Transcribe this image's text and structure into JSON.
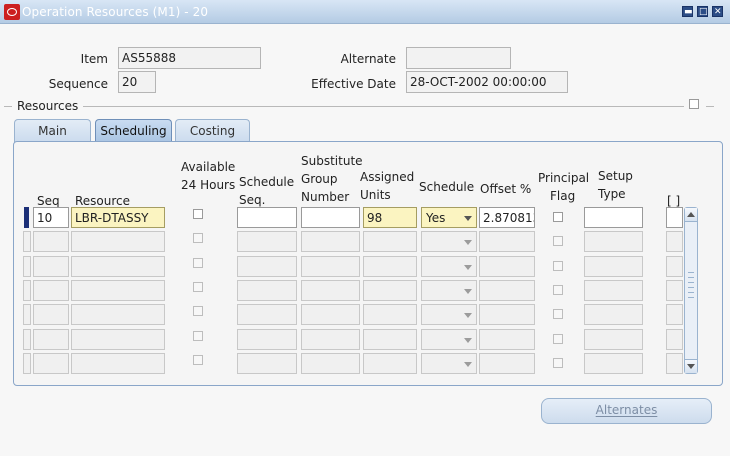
{
  "window": {
    "title": "Operation Resources (M1) - 20",
    "minimize": "▬",
    "maximize": "□",
    "close": "✕"
  },
  "header": {
    "item_label": "Item",
    "item_value": "AS55888",
    "alternate_label": "Alternate",
    "alternate_value": "",
    "sequence_label": "Sequence",
    "sequence_value": "20",
    "effective_date_label": "Effective Date",
    "effective_date_value": "28-OCT-2002 00:00:00"
  },
  "resources_section": {
    "label": "Resources"
  },
  "tabs": [
    {
      "label": "Main"
    },
    {
      "label": "Scheduling"
    },
    {
      "label": "Costing"
    }
  ],
  "columns": {
    "seq": "Seq",
    "resource": "Resource",
    "available_24_hours": [
      "Available",
      "24 Hours"
    ],
    "schedule_seq": [
      "Schedule",
      "Seq."
    ],
    "substitute_group_number": [
      "Substitute",
      "Group",
      "Number"
    ],
    "assigned_units": [
      "Assigned",
      "Units"
    ],
    "schedule": "Schedule",
    "offset_percent": "Offset %",
    "principal_flag": [
      "Principal",
      "Flag"
    ],
    "setup_type": [
      "Setup",
      "Type"
    ],
    "dff": "[ ]"
  },
  "rows": [
    {
      "seq": "10",
      "resource": "LBR-DTASSY",
      "schedule_seq": "",
      "substitute_group": "",
      "assigned_units": "98",
      "schedule": "Yes",
      "offset": "2.870813",
      "setup_type": ""
    },
    {
      "seq": "",
      "resource": "",
      "schedule_seq": "",
      "substitute_group": "",
      "assigned_units": "",
      "schedule": "",
      "offset": "",
      "setup_type": ""
    },
    {
      "seq": "",
      "resource": "",
      "schedule_seq": "",
      "substitute_group": "",
      "assigned_units": "",
      "schedule": "",
      "offset": "",
      "setup_type": ""
    },
    {
      "seq": "",
      "resource": "",
      "schedule_seq": "",
      "substitute_group": "",
      "assigned_units": "",
      "schedule": "",
      "offset": "",
      "setup_type": ""
    },
    {
      "seq": "",
      "resource": "",
      "schedule_seq": "",
      "substitute_group": "",
      "assigned_units": "",
      "schedule": "",
      "offset": "",
      "setup_type": ""
    },
    {
      "seq": "",
      "resource": "",
      "schedule_seq": "",
      "substitute_group": "",
      "assigned_units": "",
      "schedule": "",
      "offset": "",
      "setup_type": ""
    },
    {
      "seq": "",
      "resource": "",
      "schedule_seq": "",
      "substitute_group": "",
      "assigned_units": "",
      "schedule": "",
      "offset": "",
      "setup_type": ""
    }
  ],
  "buttons": {
    "alternates": "Alternates"
  }
}
